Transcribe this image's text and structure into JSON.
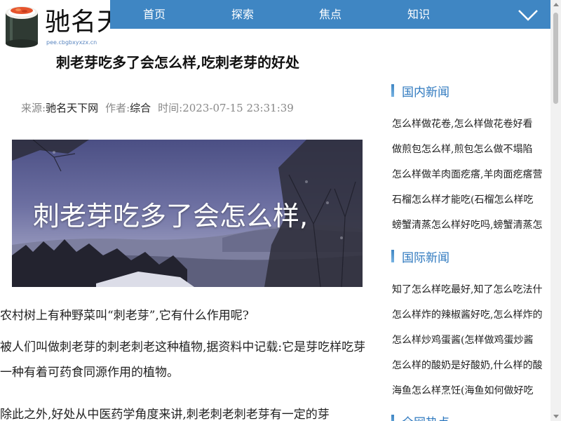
{
  "logo": {
    "title": "驰名天",
    "domain": "pee.cbgbxyxzx.cn",
    "icon": "sushi-roll-icon"
  },
  "nav": {
    "items": [
      "首页",
      "探索",
      "焦点",
      "知识"
    ],
    "toggle_icon": "chevron-down-icon",
    "color": "#3f86c3"
  },
  "article": {
    "title": "刺老芽吃多了会怎么样,吃刺老芽的好处",
    "meta": {
      "source_label": "来源:",
      "source": "驰名天下网",
      "author_label": "作者:",
      "author": "综合",
      "time_label": "时间:",
      "time": "2023-07-15 23:31:39"
    },
    "hero_text": "刺老芽吃多了会怎么样,",
    "paragraphs": [
      "农村树上有种野菜叫“刺老芽”,它有什么作用呢?",
      "被人们叫做刺老芽的刺老刺老这种植物,据资料中记载:它是芽吃样吃芽一种有着可药食同源作用的植物。",
      "除此之外,好处从中医药学角度来讲,刺老刺老刺老芽有一定的芽"
    ]
  },
  "sidebar": {
    "sections": [
      {
        "title": "国内新闻",
        "links": [
          "怎么样做花卷,怎么样做花卷好看",
          "做煎包怎么样,煎包怎么做不塌陷",
          "怎么样做羊肉面疙瘩,羊肉面疙瘩营",
          "石榴怎么样才能吃(石榴怎么样吃",
          "螃蟹清蒸怎么样好吃吗,螃蟹清蒸怎"
        ]
      },
      {
        "title": "国际新闻",
        "links": [
          "知了怎么样吃最好,知了怎么吃法什",
          "怎么样炸的辣椒酱好吃,怎么样炸的",
          "怎么样炒鸡蛋酱(怎样做鸡蛋炒酱",
          "怎么样的酸奶是好酸奶,什么样的酸",
          "海鱼怎么样烹饪(海鱼如何做好吃"
        ]
      },
      {
        "title": "全网热点",
        "links": []
      }
    ]
  }
}
